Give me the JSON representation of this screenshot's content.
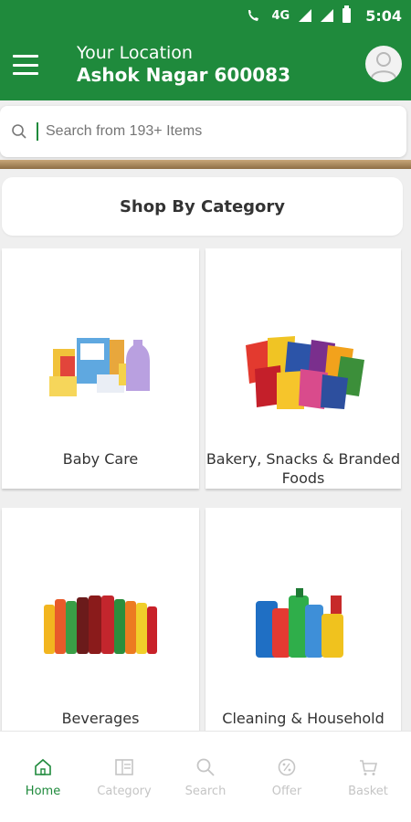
{
  "status": {
    "network": "4G",
    "time": "5:04",
    "call_badge": "4G"
  },
  "header": {
    "location_title": "Your Location",
    "location_value": "Ashok Nagar 600083",
    "menu_icon": "hamburger-menu-icon",
    "avatar_icon": "user-avatar-icon"
  },
  "search": {
    "placeholder": "Search from 193+ Items",
    "icon": "search-icon"
  },
  "section": {
    "title": "Shop By Category"
  },
  "categories": [
    {
      "label": "Baby Care",
      "image": "baby-care-products-image"
    },
    {
      "label": "Bakery, Snacks & Branded Foods",
      "image": "snack-packets-image"
    },
    {
      "label": "Beverages",
      "image": "soft-drink-bottles-image"
    },
    {
      "label": "Cleaning & Household",
      "image": "cleaning-bottles-image"
    }
  ],
  "bottom_nav": [
    {
      "label": "Home",
      "icon": "home-icon",
      "active": true
    },
    {
      "label": "Category",
      "icon": "category-icon",
      "active": false
    },
    {
      "label": "Search",
      "icon": "search-icon",
      "active": false
    },
    {
      "label": "Offer",
      "icon": "offer-icon",
      "active": false
    },
    {
      "label": "Basket",
      "icon": "basket-icon",
      "active": false
    }
  ],
  "colors": {
    "brand_green": "#1f8a3c",
    "inactive_gray": "#c5c5c5"
  }
}
